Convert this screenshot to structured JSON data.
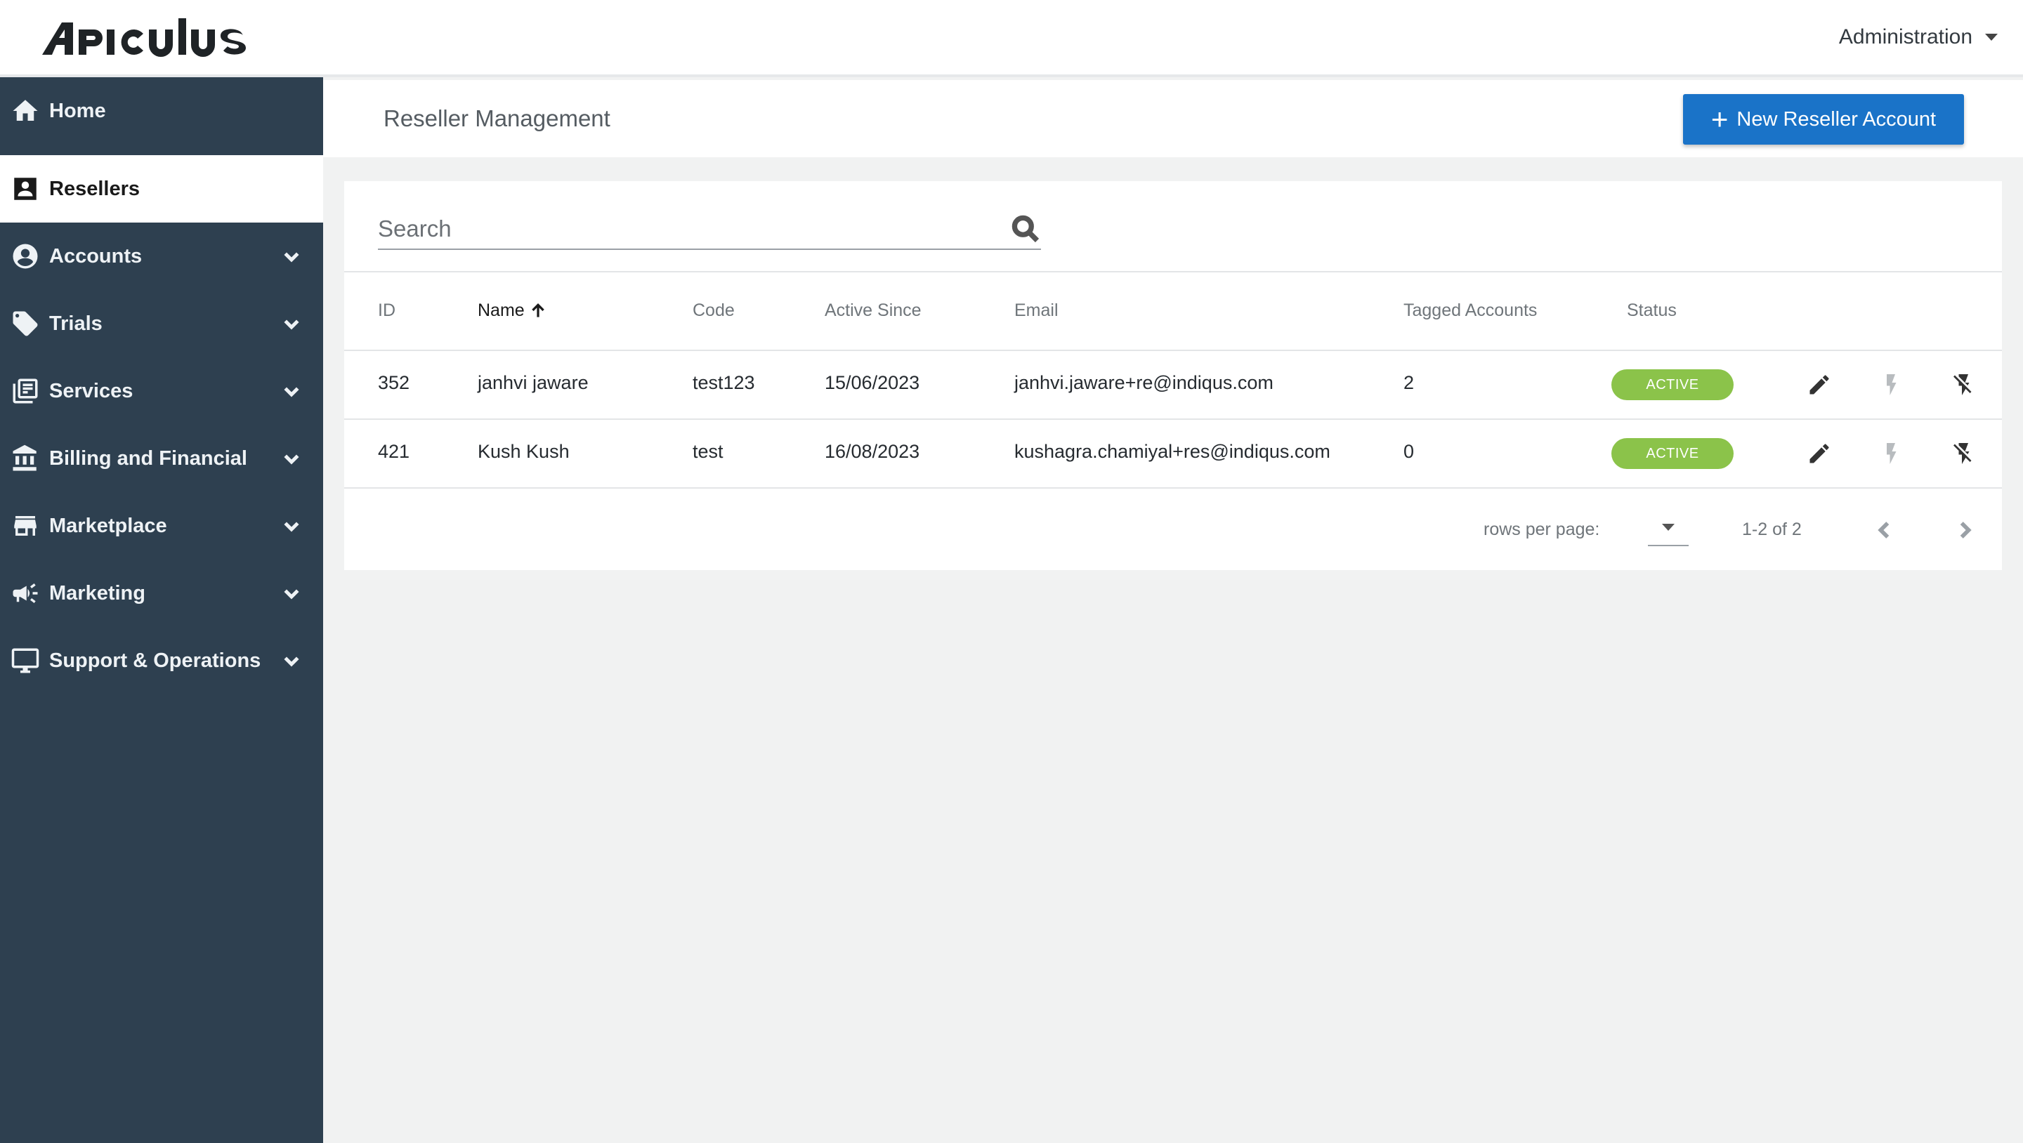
{
  "brand": {
    "logo_text": "APICULUS"
  },
  "header": {
    "admin_label": "Administration"
  },
  "sidebar": {
    "items": [
      {
        "label": "Home",
        "icon": "home-icon",
        "active": false,
        "expandable": false
      },
      {
        "label": "Resellers",
        "icon": "contact-card-icon",
        "active": true,
        "expandable": false
      },
      {
        "label": "Accounts",
        "icon": "account-circle-icon",
        "active": false,
        "expandable": true
      },
      {
        "label": "Trials",
        "icon": "tag-icon",
        "active": false,
        "expandable": true
      },
      {
        "label": "Services",
        "icon": "library-icon",
        "active": false,
        "expandable": true
      },
      {
        "label": "Billing and Financial",
        "icon": "bank-icon",
        "active": false,
        "expandable": true
      },
      {
        "label": "Marketplace",
        "icon": "store-icon",
        "active": false,
        "expandable": true
      },
      {
        "label": "Marketing",
        "icon": "megaphone-icon",
        "active": false,
        "expandable": true
      },
      {
        "label": "Support & Operations",
        "icon": "monitor-icon",
        "active": false,
        "expandable": true
      }
    ]
  },
  "page": {
    "title": "Reseller Management",
    "new_button_label": "New Reseller Account"
  },
  "search": {
    "placeholder": "Search",
    "value": ""
  },
  "table": {
    "columns": [
      "ID",
      "Name",
      "Code",
      "Active Since",
      "Email",
      "Tagged Accounts",
      "Status"
    ],
    "sorted_column": "Name",
    "rows": [
      {
        "id": "352",
        "name": "janhvi jaware",
        "code": "test123",
        "active_since": "15/06/2023",
        "email": "janhvi.jaware+re@indiqus.com",
        "tagged_accounts": "2",
        "status": "ACTIVE"
      },
      {
        "id": "421",
        "name": "Kush Kush",
        "code": "test",
        "active_since": "16/08/2023",
        "email": "kushagra.chamiyal+res@indiqus.com",
        "tagged_accounts": "0",
        "status": "ACTIVE"
      }
    ]
  },
  "pagination": {
    "rows_per_page_label": "rows per page:",
    "rows_per_page_value": "",
    "range_text": "1-2 of 2"
  },
  "colors": {
    "sidebar_bg": "#2e4050",
    "primary_button": "#1a73c8",
    "status_active": "#8bc34a",
    "page_bg": "#f1f2f2"
  }
}
